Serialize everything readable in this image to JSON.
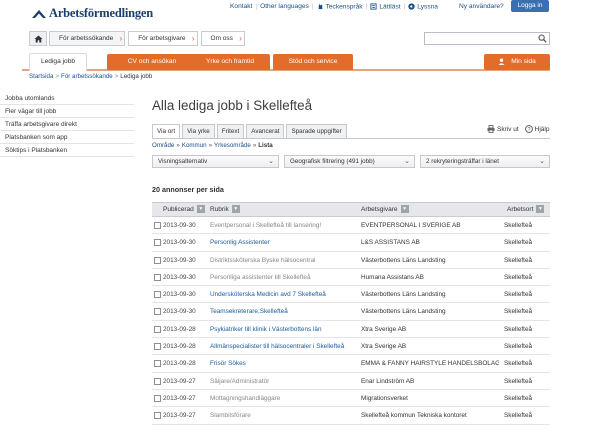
{
  "header": {
    "logo_text": "Arbetsförmedlingen",
    "links": [
      {
        "label": "Kontakt",
        "icon": ""
      },
      {
        "label": "Other languages",
        "icon": ""
      },
      {
        "label": "Teckenspråk",
        "icon": "sign-language-icon"
      },
      {
        "label": "Lättläst",
        "icon": "easy-read-icon"
      },
      {
        "label": "Lyssna",
        "icon": "speaker-icon"
      }
    ],
    "user_question": "Ny användare?",
    "login_label": "Logga in"
  },
  "top_tabs": [
    {
      "label": "För arbetssökande",
      "active": true
    },
    {
      "label": "För arbetsgivare",
      "active": false
    },
    {
      "label": "Om oss",
      "active": false
    }
  ],
  "nav": {
    "items": [
      {
        "label": "Lediga jobb",
        "active": true
      },
      {
        "label": "CV och ansökan",
        "active": false
      },
      {
        "label": "Yrke och framtid",
        "active": false
      },
      {
        "label": "Stöd och service",
        "active": false
      }
    ],
    "my_page": "Min sida"
  },
  "breadcrumb": [
    "Startsida",
    "För arbetssökande",
    "Lediga jobb"
  ],
  "sidebar": {
    "items": [
      "Jobba utomlands",
      "Fler vägar till jobb",
      "Träffa arbetsgivare direkt",
      "Platsbanken som app",
      "Söktips i Platsbanken"
    ]
  },
  "main": {
    "title": "Alla lediga jobb i Skellefteå",
    "view_tabs": [
      {
        "label": "Via ort",
        "active": true
      },
      {
        "label": "Via yrke",
        "active": false
      },
      {
        "label": "Fritext",
        "active": false
      },
      {
        "label": "Avancerat",
        "active": false
      },
      {
        "label": "Sparade uppgifter",
        "active": false
      }
    ],
    "tools": {
      "print": "Skriv ut",
      "help": "Hjälp"
    },
    "sub_breadcrumb": [
      "Område",
      "Kommun",
      "Yrkesområde",
      "Lista"
    ],
    "filters": [
      "Visningsalternativ",
      "Geografisk filtrering (491 jobb)",
      "2 rekryteringsträffar i länet"
    ],
    "count_title": "20 annonser per sida",
    "table": {
      "headers": [
        "Publicerad",
        "Rubrik",
        "Arbetsgivare",
        "Arbetsort"
      ],
      "rows": [
        {
          "date": "2013-09-30",
          "title": "Eventpersonal i Skellefteå till lansering!",
          "employer": "EVENTPERSONAL I SVERIGE AB",
          "place": "Skellefteå",
          "state": "visited"
        },
        {
          "date": "2013-09-30",
          "title": "Personlig Assistenter",
          "employer": "L&S ASSISTANS AB",
          "place": "Skellefteå",
          "state": "link"
        },
        {
          "date": "2013-09-30",
          "title": "Distriktssköterska Byske hälsocentral",
          "employer": "Västerbottens Läns Landsting",
          "place": "Skellefteå",
          "state": "visited"
        },
        {
          "date": "2013-09-30",
          "title": "Personliga assistenter till Skellefteå",
          "employer": "Humana Assistans AB",
          "place": "Skellefteå",
          "state": "visited"
        },
        {
          "date": "2013-09-30",
          "title": "Undersköterska Medicin avd 7 Skellefteå",
          "employer": "Västerbottens Läns Landsting",
          "place": "Skellefteå",
          "state": "link"
        },
        {
          "date": "2013-09-30",
          "title": "Teamsekreterare,Skellefteå",
          "employer": "Västerbottens Läns Landsting",
          "place": "Skellefteå",
          "state": "link"
        },
        {
          "date": "2013-09-28",
          "title": "Psykiatriker till klinik i Västerbottens län",
          "employer": "Xtra Sverige AB",
          "place": "Skellefteå",
          "state": "link"
        },
        {
          "date": "2013-09-28",
          "title": "Allmänspecialister till hälsocentraler i Skellefteå",
          "employer": "Xtra Sverige AB",
          "place": "Skellefteå",
          "state": "link"
        },
        {
          "date": "2013-09-28",
          "title": "Frisör Sökes",
          "employer": "EMMA & FANNY HAIRSTYLE HANDELSBOLAG",
          "place": "Skellefteå",
          "state": "link"
        },
        {
          "date": "2013-09-27",
          "title": "Säljare/Administratör",
          "employer": "Enar Lindström AB",
          "place": "Skellefteå",
          "state": "visited"
        },
        {
          "date": "2013-09-27",
          "title": "Mottagningshandläggare",
          "employer": "Migrationsverket",
          "place": "Skellefteå",
          "state": "visited"
        },
        {
          "date": "2013-09-27",
          "title": "Slambilsförare",
          "employer": "Skellefteå kommun Tekniska kontoret",
          "place": "Skellefteå",
          "state": "visited"
        }
      ]
    }
  },
  "colors": {
    "brand_blue": "#1b3e6b",
    "link_blue": "#1a5c9e",
    "accent_orange": "#e46c2b",
    "login_blue": "#3a6fb0"
  }
}
